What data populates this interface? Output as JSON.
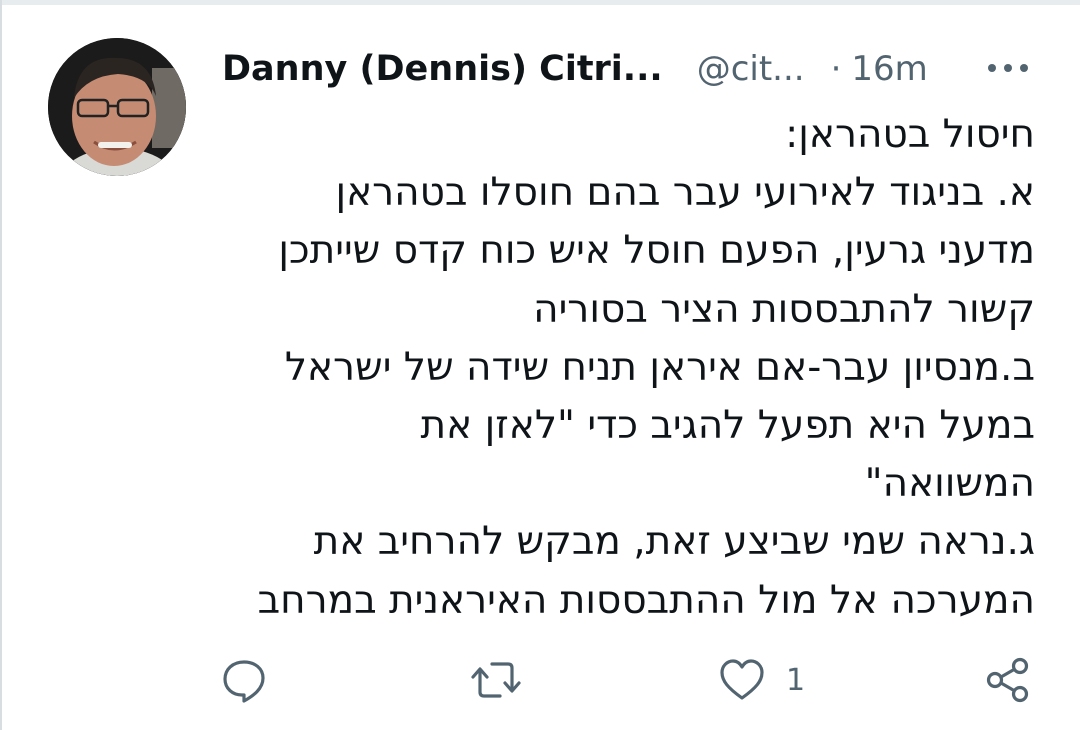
{
  "tweet": {
    "author_name": "Danny (Dennis) Citri...",
    "handle": "@cit...",
    "separator": "·",
    "time": "16m",
    "body_lines": [
      "חיסול בטהראן:",
      "א. בניגוד לאירועי עבר בהם חוסלו בטהראן",
      "מדעני גרעין, הפעם חוסל איש כוח קדס שייתכן",
      "קשור להתבססות הציר בסוריה",
      "ב.מנסיון עבר-אם איראן תניח שידה של ישראל",
      "במעל היא תפעל להגיב כדי \"לאזן  את",
      "המשוואה\"",
      "ג.נראה שמי שביצע זאת, מבקש להרחיב את",
      "המערכה אל מול ההתבססות האיראנית במרחב"
    ],
    "like_count": "1"
  },
  "icons": {
    "more": "more-dots-icon",
    "reply": "reply-bubble-icon",
    "retweet": "retweet-icon",
    "like": "heart-icon",
    "share": "share-icon"
  },
  "colors": {
    "text_primary": "#0f1419",
    "text_secondary": "#536471",
    "icon_gray": "#536471"
  }
}
